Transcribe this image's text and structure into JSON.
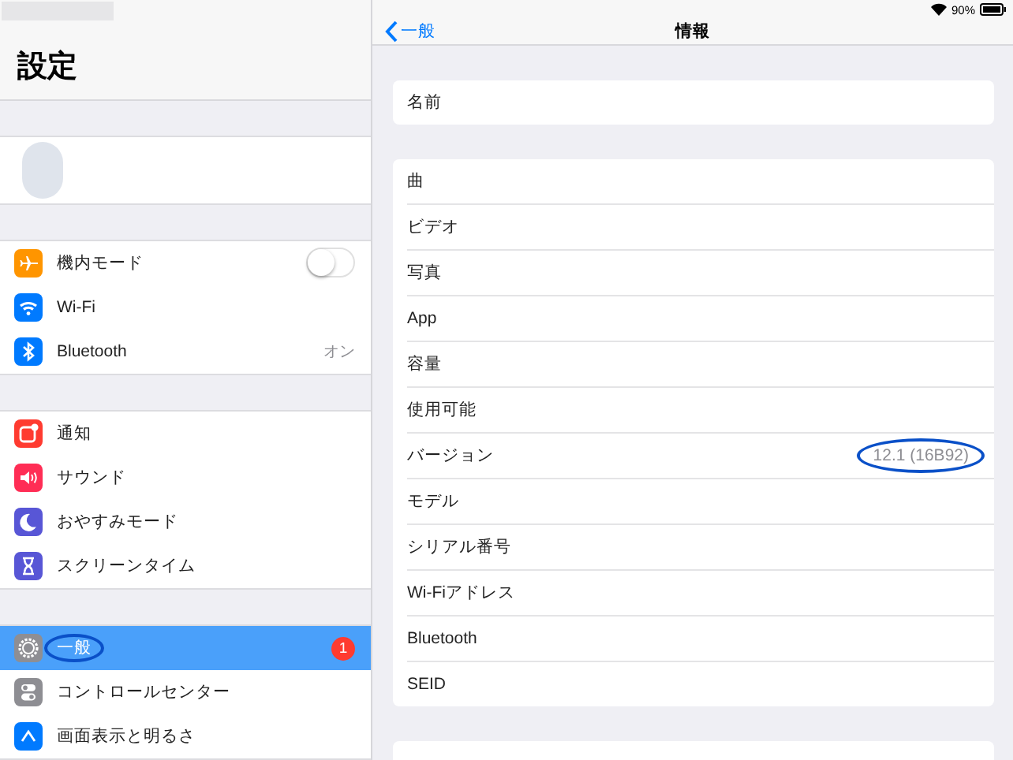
{
  "status_bar": {
    "battery": "90%"
  },
  "sidebar": {
    "title": "設定",
    "groups": [
      [
        {
          "label": "機内モード",
          "kind": "toggle",
          "on": false,
          "selected": false
        },
        {
          "label": "Wi-Fi",
          "kind": "plain",
          "selected": false
        },
        {
          "label": "Bluetooth",
          "kind": "value",
          "value": "オン",
          "selected": false
        }
      ],
      [
        {
          "label": "通知",
          "kind": "plain",
          "selected": false
        },
        {
          "label": "サウンド",
          "kind": "plain",
          "selected": false
        },
        {
          "label": "おやすみモード",
          "kind": "plain",
          "selected": false
        },
        {
          "label": "スクリーンタイム",
          "kind": "plain",
          "selected": false
        }
      ],
      [
        {
          "label": "一般",
          "kind": "badge",
          "badge": "1",
          "selected": true,
          "circled": true
        },
        {
          "label": "コントロールセンター",
          "kind": "plain",
          "selected": false
        },
        {
          "label": "画面表示と明るさ",
          "kind": "plain",
          "selected": false
        }
      ]
    ]
  },
  "detail": {
    "back": "一般",
    "title": "情報",
    "groups": [
      [
        {
          "label": "名前"
        }
      ],
      [
        {
          "label": "曲"
        },
        {
          "label": "ビデオ"
        },
        {
          "label": "写真"
        },
        {
          "label": "App"
        },
        {
          "label": "容量"
        },
        {
          "label": "使用可能"
        },
        {
          "label": "バージョン",
          "value": "12.1 (16B92)",
          "circled": true
        },
        {
          "label": "モデル"
        },
        {
          "label": "シリアル番号"
        },
        {
          "label": "Wi-Fiアドレス"
        },
        {
          "label": "Bluetooth"
        },
        {
          "label": "SEID"
        }
      ]
    ]
  }
}
